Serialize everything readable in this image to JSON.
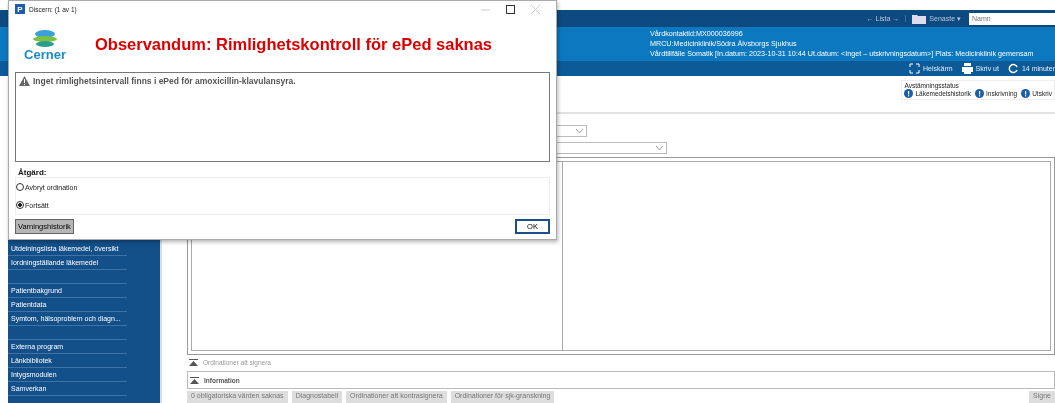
{
  "app": {
    "nav": {
      "back_label": "← Lista →",
      "recent": "Senaste ▾",
      "search": {
        "placeholder": "Namn"
      }
    },
    "patient_info": [
      "Vårdkontaktid:MX000036996",
      "MRCU:Medicinklinik/Södra Älvsborgs Sjukhus",
      "Vårdtillfälle Somatik [In.datum: 2023-10-31 10:44 Ut.datum: <Inget – utskrivningsdatum>] Plats: Medicinklinik gemensam"
    ],
    "toolbar": [
      {
        "kind": "fullscreen",
        "label": "Helskärm"
      },
      {
        "kind": "print",
        "label": "Skriv ut"
      },
      {
        "kind": "refresh",
        "label": "14 minuter"
      }
    ],
    "reconciliation": {
      "title": "Avstämningsstatus",
      "items": [
        "Läkemedelshistorik",
        "Inskrivning",
        "Utskriv"
      ]
    },
    "sidebar": {
      "groups": [
        [
          "Utdelningslista läkemedel, översikt",
          "Iordningställande läkemedel"
        ],
        [
          "Patientbakgrund",
          "Patientdata",
          "Symtom, hälsoproblem och diagn..."
        ],
        [
          "Externa program",
          "Länkbibliotek",
          "Intygsmodulen",
          "Samverkan"
        ]
      ]
    },
    "sections": [
      {
        "label": "Ordinationer att signera",
        "kind": "plain"
      },
      {
        "label": "Information",
        "kind": "boxed"
      }
    ],
    "bottom_buttons": [
      "0 obligatoriska värden saknas",
      "Diagnostabell",
      "Ordinationer att kontrasignera",
      "Ordinationer för sjk-granskning"
    ],
    "sign_button": "Signe"
  },
  "dialog": {
    "app_icon": "P",
    "title": "Discern: (1 av 1)",
    "logo": "Cerner",
    "heading": "Observandum: Rimlighetskontroll för ePed saknas",
    "message": "Inget rimlighetsintervall finns i ePed för amoxicillin-klavulansyra.",
    "action_label": "Åtgärd:",
    "options": [
      {
        "label": "Avbryt ordination",
        "selected": false
      },
      {
        "label": "Fortsätt",
        "selected": true
      }
    ],
    "history_button": "Varningshistorik",
    "ok_button": "OK"
  }
}
